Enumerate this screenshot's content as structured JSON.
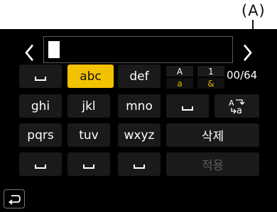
{
  "callout_label": "(A)",
  "char_counter": "00/64",
  "keys": {
    "space": "␣",
    "abc": "abc",
    "def": "def",
    "ghi": "ghi",
    "jkl": "jkl",
    "mno": "mno",
    "pqrs": "pqrs",
    "tuv": "tuv",
    "wxyz": "wxyz",
    "delete": "삭제",
    "apply": "적용"
  },
  "case_toggle": {
    "upper": "A",
    "lower": "a"
  },
  "symbol_toggle": {
    "number": "1",
    "symbol": "&"
  },
  "icons": {
    "left": "chevron-left-icon",
    "right": "chevron-right-icon",
    "case_switch": "case-switch-icon",
    "back": "back-arrow-icon"
  },
  "colors": {
    "selected": "#f2c200",
    "key_bg": "#1a1a1a"
  }
}
